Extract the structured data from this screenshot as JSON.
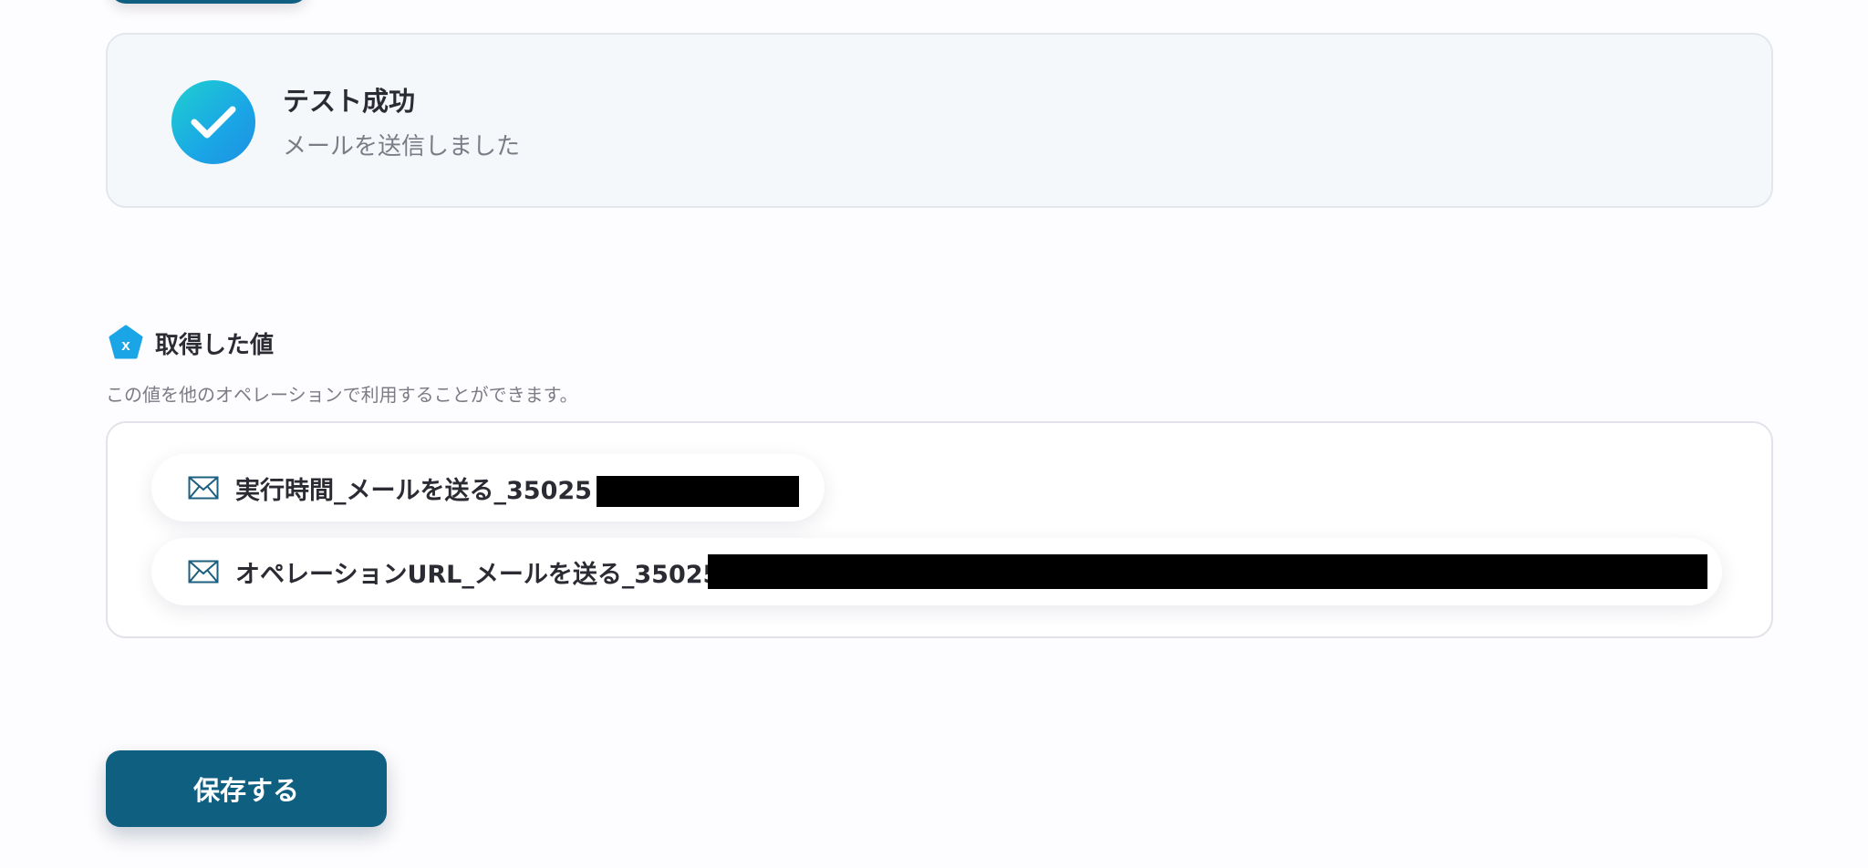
{
  "test_result": {
    "title": "テスト成功",
    "message": "メールを送信しました",
    "status_color": "#1ab5e0"
  },
  "retrieved_values": {
    "title": "取得した値",
    "description": "この値を他のオペレーションで利用することができます。",
    "items": [
      {
        "label": "実行時間_メールを送る_35025",
        "value_redacted": true,
        "icon": "mail-icon"
      },
      {
        "label": "オペレーションURL_メールを送る_35025",
        "value_redacted": true,
        "icon": "mail-icon"
      }
    ]
  },
  "actions": {
    "save_label": "保存する",
    "primary_color": "#0f5f80"
  }
}
